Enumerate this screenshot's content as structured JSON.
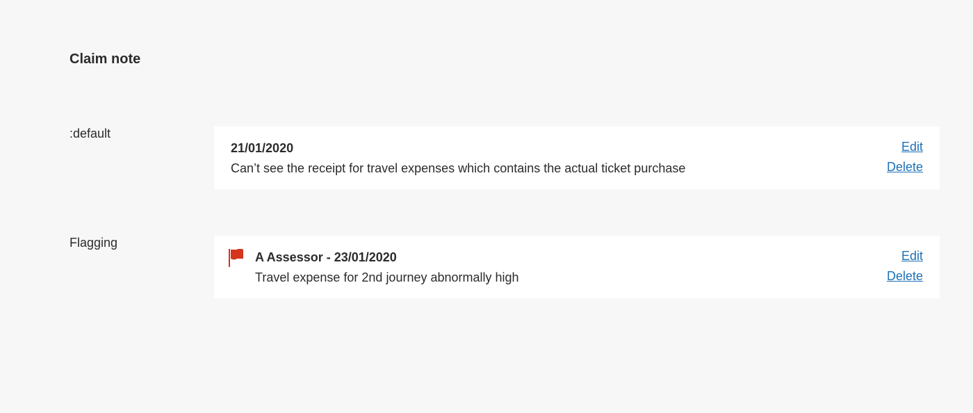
{
  "page": {
    "title": "Claim note"
  },
  "rows": [
    {
      "label": ":default",
      "note": {
        "heading": "21/01/2020",
        "text": "Can’t see the receipt for travel expenses which contains the actual ticket purchase",
        "edit_label": "Edit",
        "delete_label": "Delete"
      }
    },
    {
      "label": "Flagging",
      "note": {
        "icon": "flag-icon",
        "heading": "A Assessor - 23/01/2020",
        "text": "Travel expense for 2nd journey abnormally high",
        "edit_label": "Edit",
        "delete_label": "Delete"
      }
    }
  ],
  "colors": {
    "background": "#f7f7f7",
    "card": "#ffffff",
    "link": "#1d70b8",
    "flag": "#d4351c",
    "text": "#2b2b2b"
  }
}
